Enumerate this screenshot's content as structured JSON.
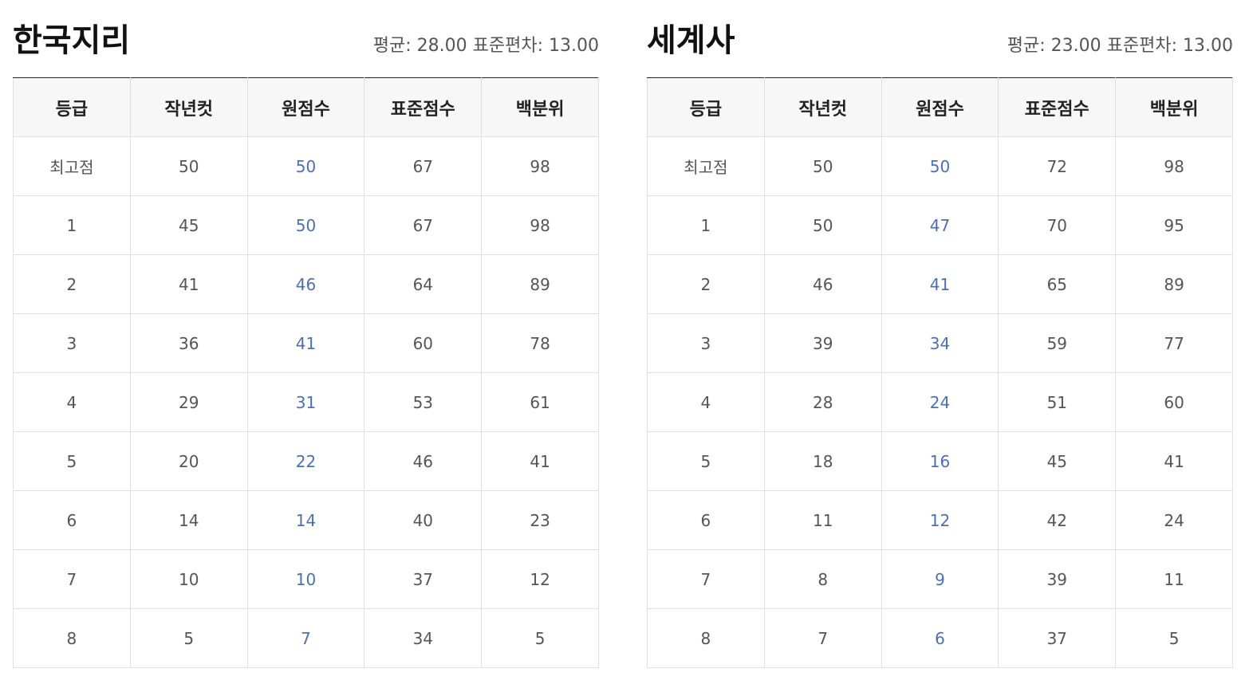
{
  "panels": [
    {
      "title": "한국지리",
      "stats": "평균: 28.00 표준편차: 13.00",
      "headers": [
        "등급",
        "작년컷",
        "원점수",
        "표준점수",
        "백분위"
      ],
      "rows": [
        [
          "최고점",
          "50",
          "50",
          "67",
          "98"
        ],
        [
          "1",
          "45",
          "50",
          "67",
          "98"
        ],
        [
          "2",
          "41",
          "46",
          "64",
          "89"
        ],
        [
          "3",
          "36",
          "41",
          "60",
          "78"
        ],
        [
          "4",
          "29",
          "31",
          "53",
          "61"
        ],
        [
          "5",
          "20",
          "22",
          "46",
          "41"
        ],
        [
          "6",
          "14",
          "14",
          "40",
          "23"
        ],
        [
          "7",
          "10",
          "10",
          "37",
          "12"
        ],
        [
          "8",
          "5",
          "7",
          "34",
          "5"
        ]
      ]
    },
    {
      "title": "세계사",
      "stats": "평균: 23.00 표준편차: 13.00",
      "headers": [
        "등급",
        "작년컷",
        "원점수",
        "표준점수",
        "백분위"
      ],
      "rows": [
        [
          "최고점",
          "50",
          "50",
          "72",
          "98"
        ],
        [
          "1",
          "50",
          "47",
          "70",
          "95"
        ],
        [
          "2",
          "46",
          "41",
          "65",
          "89"
        ],
        [
          "3",
          "39",
          "34",
          "59",
          "77"
        ],
        [
          "4",
          "28",
          "24",
          "51",
          "60"
        ],
        [
          "5",
          "18",
          "16",
          "45",
          "41"
        ],
        [
          "6",
          "11",
          "12",
          "42",
          "24"
        ],
        [
          "7",
          "8",
          "9",
          "39",
          "11"
        ],
        [
          "8",
          "7",
          "6",
          "37",
          "5"
        ]
      ]
    }
  ],
  "colors": {
    "raw_score": "#4a6fb8",
    "header_bg": "#f7f7f7",
    "border": "#e0e0e0",
    "top_rule": "#222222"
  }
}
